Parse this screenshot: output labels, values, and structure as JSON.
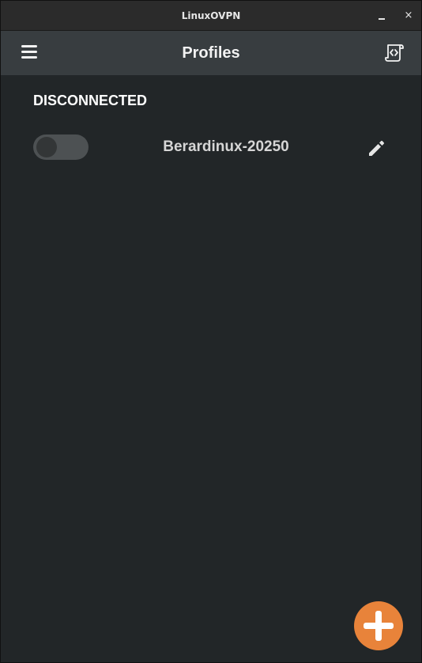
{
  "window": {
    "title": "LinuxOVPN",
    "minimize_icon": "minimize-icon",
    "close_label": "×"
  },
  "header": {
    "title": "Profiles",
    "menu_icon": "hamburger-menu-icon",
    "log_icon": "code-scroll-icon"
  },
  "status": {
    "label": "DISCONNECTED"
  },
  "profiles": [
    {
      "name": "Berardinux-20250",
      "connected": false,
      "edit_icon": "pencil-icon"
    }
  ],
  "fab": {
    "icon": "plus-icon"
  },
  "colors": {
    "titlebar": "#2b2b2b",
    "header": "#383d40",
    "background": "#222628",
    "accent": "#e8833a",
    "toggle_track": "#4d5153"
  }
}
